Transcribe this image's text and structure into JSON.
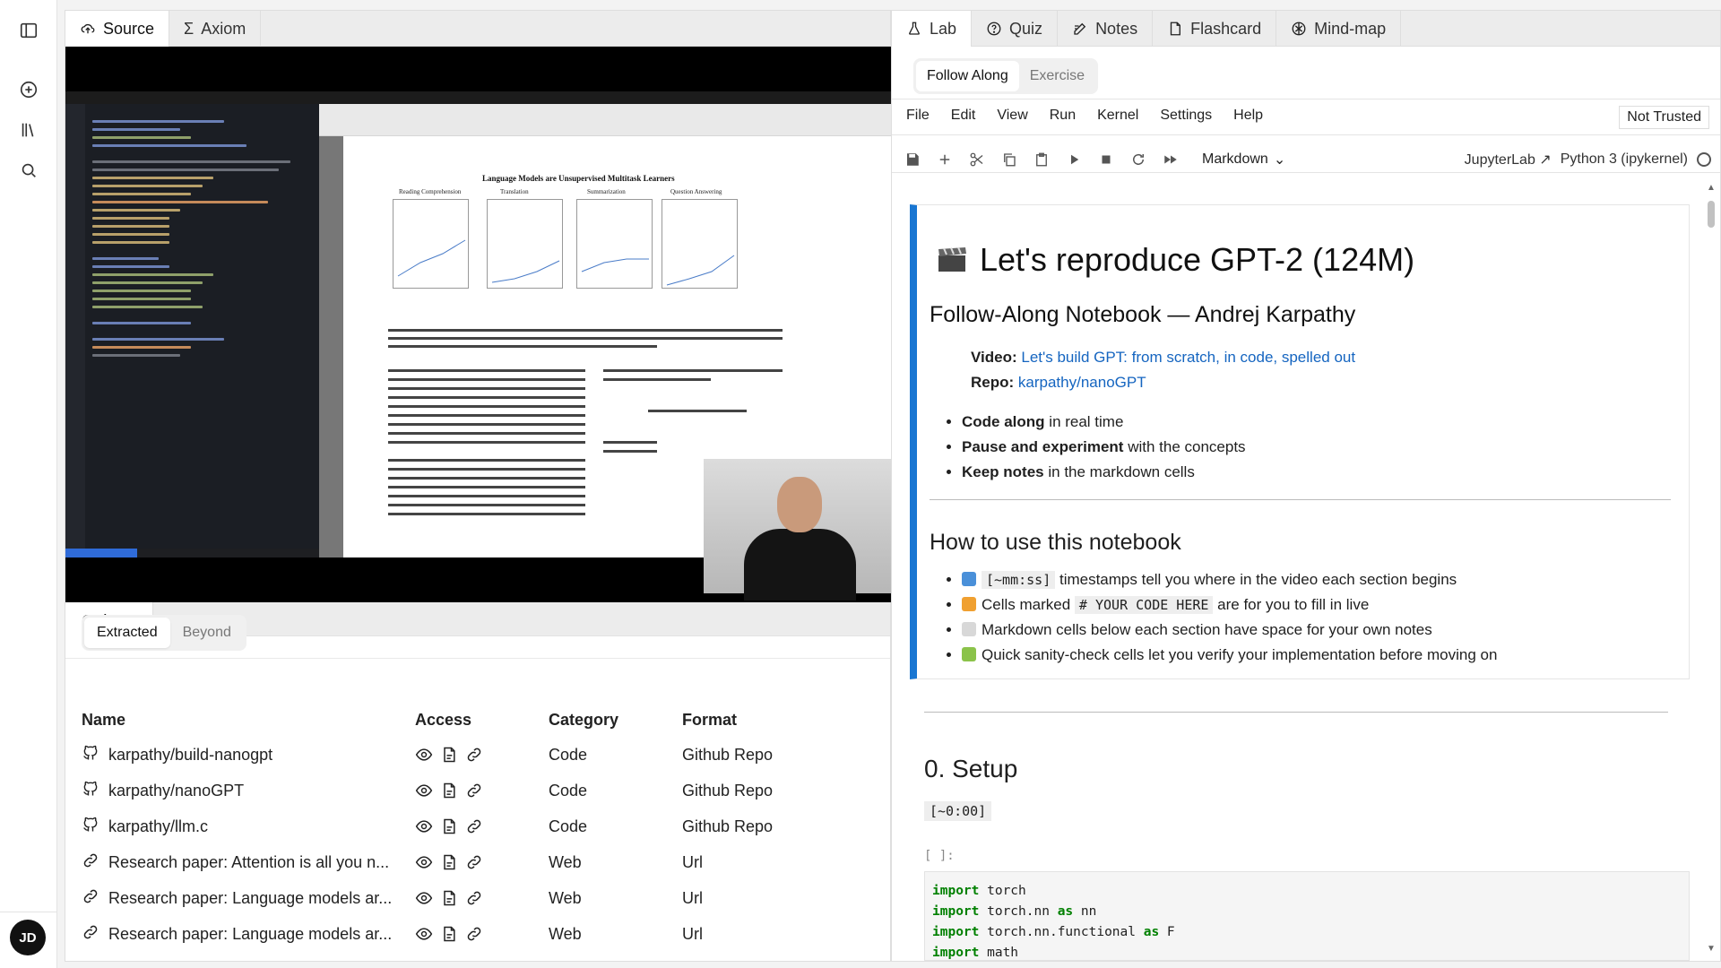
{
  "user": {
    "initials": "JD"
  },
  "left_panel": {
    "tabs": [
      {
        "label": "Source",
        "icon": "cloud-upload-icon"
      },
      {
        "label": "Axiom",
        "icon": "sigma-icon"
      }
    ],
    "lens": {
      "tab_label": "Lens",
      "segments": [
        "Extracted",
        "Beyond"
      ],
      "columns": [
        "Name",
        "Access",
        "Category",
        "Format"
      ],
      "rows": [
        {
          "icon": "github-icon",
          "name": "karpathy/build-nanogpt",
          "category": "Code",
          "format": "Github Repo"
        },
        {
          "icon": "github-icon",
          "name": "karpathy/nanoGPT",
          "category": "Code",
          "format": "Github Repo"
        },
        {
          "icon": "github-icon",
          "name": "karpathy/llm.c",
          "category": "Code",
          "format": "Github Repo"
        },
        {
          "icon": "link-icon",
          "name": "Research paper: Attention is all you n...",
          "category": "Web",
          "format": "Url"
        },
        {
          "icon": "link-icon",
          "name": "Research paper: Language models ar...",
          "category": "Web",
          "format": "Url"
        },
        {
          "icon": "link-icon",
          "name": "Research paper: Language models ar...",
          "category": "Web",
          "format": "Url"
        }
      ]
    },
    "video": {
      "paper_title": "Language Models are Unsupervised Multitask Learners",
      "plot_titles": [
        "Reading Comprehension",
        "Translation",
        "Summarization",
        "Question Answering"
      ]
    }
  },
  "right_panel": {
    "tabs": [
      {
        "label": "Lab",
        "icon": "flask-icon"
      },
      {
        "label": "Quiz",
        "icon": "question-icon"
      },
      {
        "label": "Notes",
        "icon": "edit-note-icon"
      },
      {
        "label": "Flashcard",
        "icon": "card-icon"
      },
      {
        "label": "Mind-map",
        "icon": "brain-icon"
      }
    ],
    "modes": [
      "Follow Along",
      "Exercise"
    ],
    "menu": [
      "File",
      "Edit",
      "View",
      "Run",
      "Kernel",
      "Settings",
      "Help"
    ],
    "trust_status": "Not Trusted",
    "cell_type": "Markdown",
    "jupyterlab_label": "JupyterLab",
    "kernel_label": "Python 3 (ipykernel)",
    "notebook": {
      "title": "Let's reproduce GPT-2 (124M)",
      "subtitle": "Follow-Along Notebook — Andrej Karpathy",
      "video_label": "Video:",
      "video_link": "Let's build GPT: from scratch, in code, spelled out",
      "repo_label": "Repo:",
      "repo_link": "karpathy/nanoGPT",
      "bullets": [
        {
          "bold": "Code along",
          "rest": " in real time"
        },
        {
          "bold": "Pause and experiment",
          "rest": " with the concepts"
        },
        {
          "bold": "Keep notes",
          "rest": " in the markdown cells"
        }
      ],
      "how_to_title": "How to use this notebook",
      "how_to": {
        "ts_code": "[~mm:ss]",
        "ts_text": " timestamps tell you where in the video each section begins",
        "cells_pre": "Cells marked ",
        "cells_code": "# YOUR CODE HERE",
        "cells_post": " are for you to fill in live",
        "md_text": "Markdown cells below each section have space for your own notes",
        "sanity_text": "Quick sanity-check cells let you verify your implementation before moving on"
      },
      "setup_title": "0. Setup",
      "setup_timestamp": "[~0:00]",
      "prompt": "[ ]:",
      "code": [
        {
          "kw": "import",
          "rest": " torch"
        },
        {
          "kw": "import",
          "rest": " torch.nn ",
          "kw2": "as",
          "rest2": " nn"
        },
        {
          "kw": "import",
          "rest": " torch.nn.functional ",
          "kw2": "as",
          "rest2": " F"
        },
        {
          "kw": "import",
          "rest": " math"
        }
      ]
    }
  }
}
